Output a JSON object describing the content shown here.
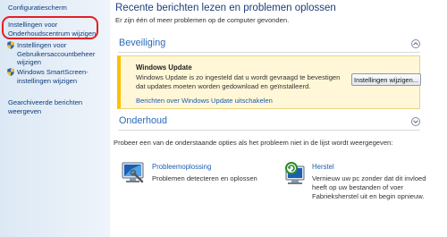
{
  "sidebar": {
    "items": [
      {
        "label": "Configuratiescherm"
      },
      {
        "label": "Instellingen voor Onderhoudscentrum wijzigen"
      },
      {
        "label": "Instellingen voor Gebruikersaccountbeheer wijzigen"
      },
      {
        "label": "Windows SmartScreen-instellingen wijzigen"
      },
      {
        "label": "Gearchiveerde berichten weergeven"
      }
    ]
  },
  "header": {
    "title": "Recente berichten lezen en problemen oplossen",
    "description": "Er zijn één of meer problemen op de computer gevonden."
  },
  "security": {
    "title": "Beveiliging",
    "alert": {
      "title": "Windows Update",
      "text": "Windows Update is zo ingesteld dat u wordt gevraagd te bevestigen dat updates moeten worden gedownload en geïnstalleerd.",
      "button": "Instellingen wijzigen...",
      "link": "Berichten over Windows Update uitschakelen"
    }
  },
  "maintenance": {
    "title": "Onderhoud"
  },
  "help": {
    "text": "Probeer een van de onderstaande opties als het probleem niet in de lijst wordt weergegeven:",
    "troubleshoot": {
      "title": "Probleemoplossing",
      "description": "Problemen detecteren en oplossen"
    },
    "recovery": {
      "title": "Herstel",
      "description": "Vernieuw uw pc zonder dat dit invloed heeft op uw bestanden of voer Fabrieksherstel uit en begin opnieuw."
    }
  },
  "colors": {
    "accent": "#2a6ab8",
    "link": "#1d5cb0",
    "alert_border": "#ffbf00",
    "highlight_ring": "#e21f26"
  },
  "icons": {
    "shield": "uac-shield-icon",
    "troubleshoot": "troubleshoot-icon",
    "recovery": "recovery-icon"
  }
}
